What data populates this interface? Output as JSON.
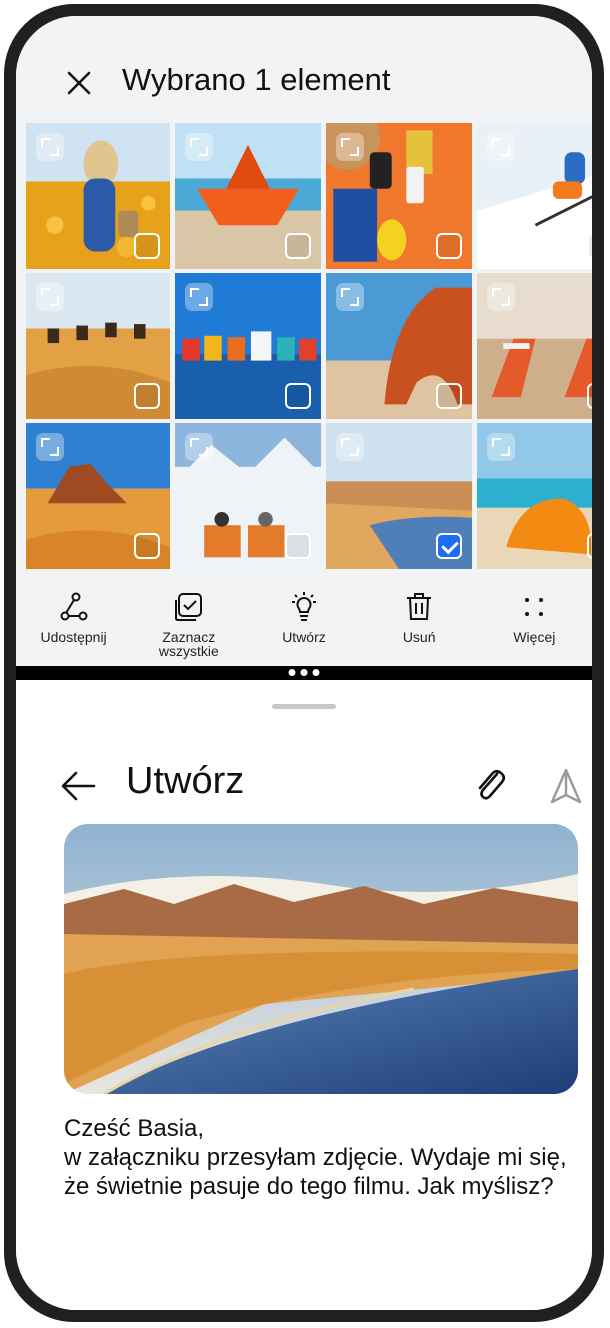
{
  "gallery": {
    "title": "Wybrano 1 element",
    "close_icon": "close-icon",
    "photos": [
      {
        "subject": "woman in sunflower field",
        "selected": false
      },
      {
        "subject": "paper boat on beach",
        "selected": false
      },
      {
        "subject": "beach items on orange towel",
        "selected": false
      },
      {
        "subject": "skier on snow slope",
        "selected": false
      },
      {
        "subject": "camel caravan in desert",
        "selected": false
      },
      {
        "subject": "colorful waterfront houses",
        "selected": false
      },
      {
        "subject": "red rock arch by sea",
        "selected": false
      },
      {
        "subject": "beach chairs on sand",
        "selected": false
      },
      {
        "subject": "desert rock formation",
        "selected": false
      },
      {
        "subject": "couple on snowy mountain",
        "selected": false
      },
      {
        "subject": "sandy lakeshore",
        "selected": true
      },
      {
        "subject": "orange umbrella on beach",
        "selected": false
      }
    ],
    "toolbar": {
      "share": "Udostępnij",
      "select_all": "Zaznacz\nwszystkie",
      "create": "Utwórz",
      "delete": "Usuń",
      "more": "Więcej"
    }
  },
  "compose": {
    "title": "Utwórz",
    "back_icon": "back-arrow-icon",
    "attach_icon": "paperclip-icon",
    "send_icon": "send-icon",
    "greeting": "Cześć Basia,",
    "body": "w załączniku przesyłam zdjęcie. Wydaje mi się, że świetnie pasuje do tego filmu. Jak myślisz?"
  },
  "colors": {
    "accent": "#1e6cf2",
    "top_pane_bg": "#f1f3f5"
  }
}
